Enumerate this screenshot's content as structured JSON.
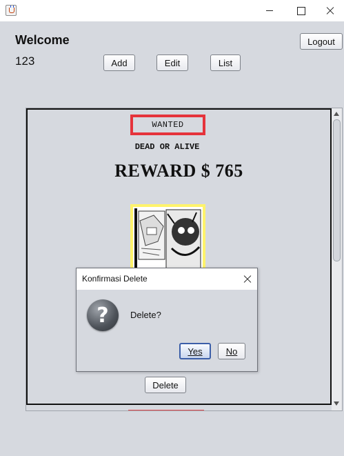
{
  "window": {
    "icon": "java-coffee-icon"
  },
  "header": {
    "welcome": "Welcome",
    "username": "123",
    "add_label": "Add",
    "edit_label": "Edit",
    "list_label": "List",
    "logout_label": "Logout"
  },
  "card": {
    "wanted_label": "WANTED",
    "subtitle": "DEAD OR ALIVE",
    "reward_text": "REWARD $  765",
    "delete_label": "Delete",
    "border_accent": "#e5333b",
    "poster_frame_color": "#fff36b"
  },
  "dialog": {
    "title": "Konfirmasi Delete",
    "message": "Delete?",
    "yes_label": "Yes",
    "no_label": "No",
    "icon": "question-icon"
  }
}
